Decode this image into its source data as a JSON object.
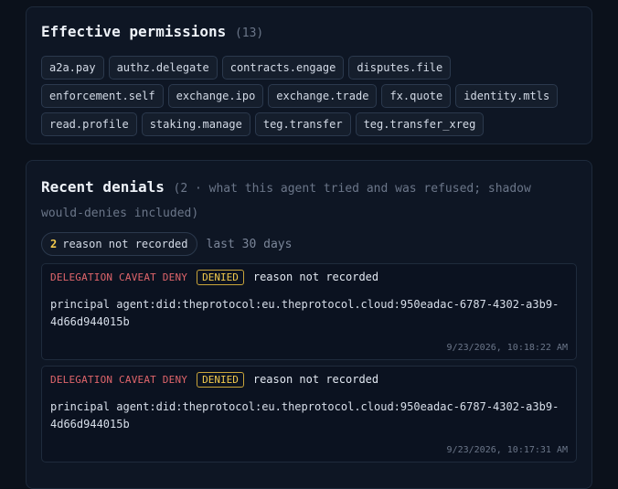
{
  "permissions": {
    "title": "Effective permissions",
    "count": "(13)",
    "items": [
      "a2a.pay",
      "authz.delegate",
      "contracts.engage",
      "disputes.file",
      "enforcement.self",
      "exchange.ipo",
      "exchange.trade",
      "fx.quote",
      "identity.mtls",
      "read.profile",
      "staking.manage",
      "teg.transfer",
      "teg.transfer_xreg"
    ]
  },
  "denials": {
    "title": "Recent denials",
    "subtitle": "(2 · what this agent tried and was refused; shadow would-denies included)",
    "filter": {
      "count": "2",
      "label": "reason not recorded",
      "range": "last 30 days"
    },
    "entries": [
      {
        "kind": "DELEGATION CAVEAT DENY",
        "badge": "DENIED",
        "reason": "reason not recorded",
        "detail": "principal agent:did:theprotocol:eu.theprotocol.cloud:950eadac-6787-4302-a3b9-4d66d944015b",
        "timestamp": "9/23/2026, 10:18:22 AM"
      },
      {
        "kind": "DELEGATION CAVEAT DENY",
        "badge": "DENIED",
        "reason": "reason not recorded",
        "detail": "principal agent:did:theprotocol:eu.theprotocol.cloud:950eadac-6787-4302-a3b9-4d66d944015b",
        "timestamp": "9/23/2026, 10:17:31 AM"
      }
    ]
  },
  "colors": {
    "background": "#0b111b",
    "card": "#0e1624",
    "deny_red": "#e0656b",
    "badge_yellow": "#f2c94c"
  }
}
